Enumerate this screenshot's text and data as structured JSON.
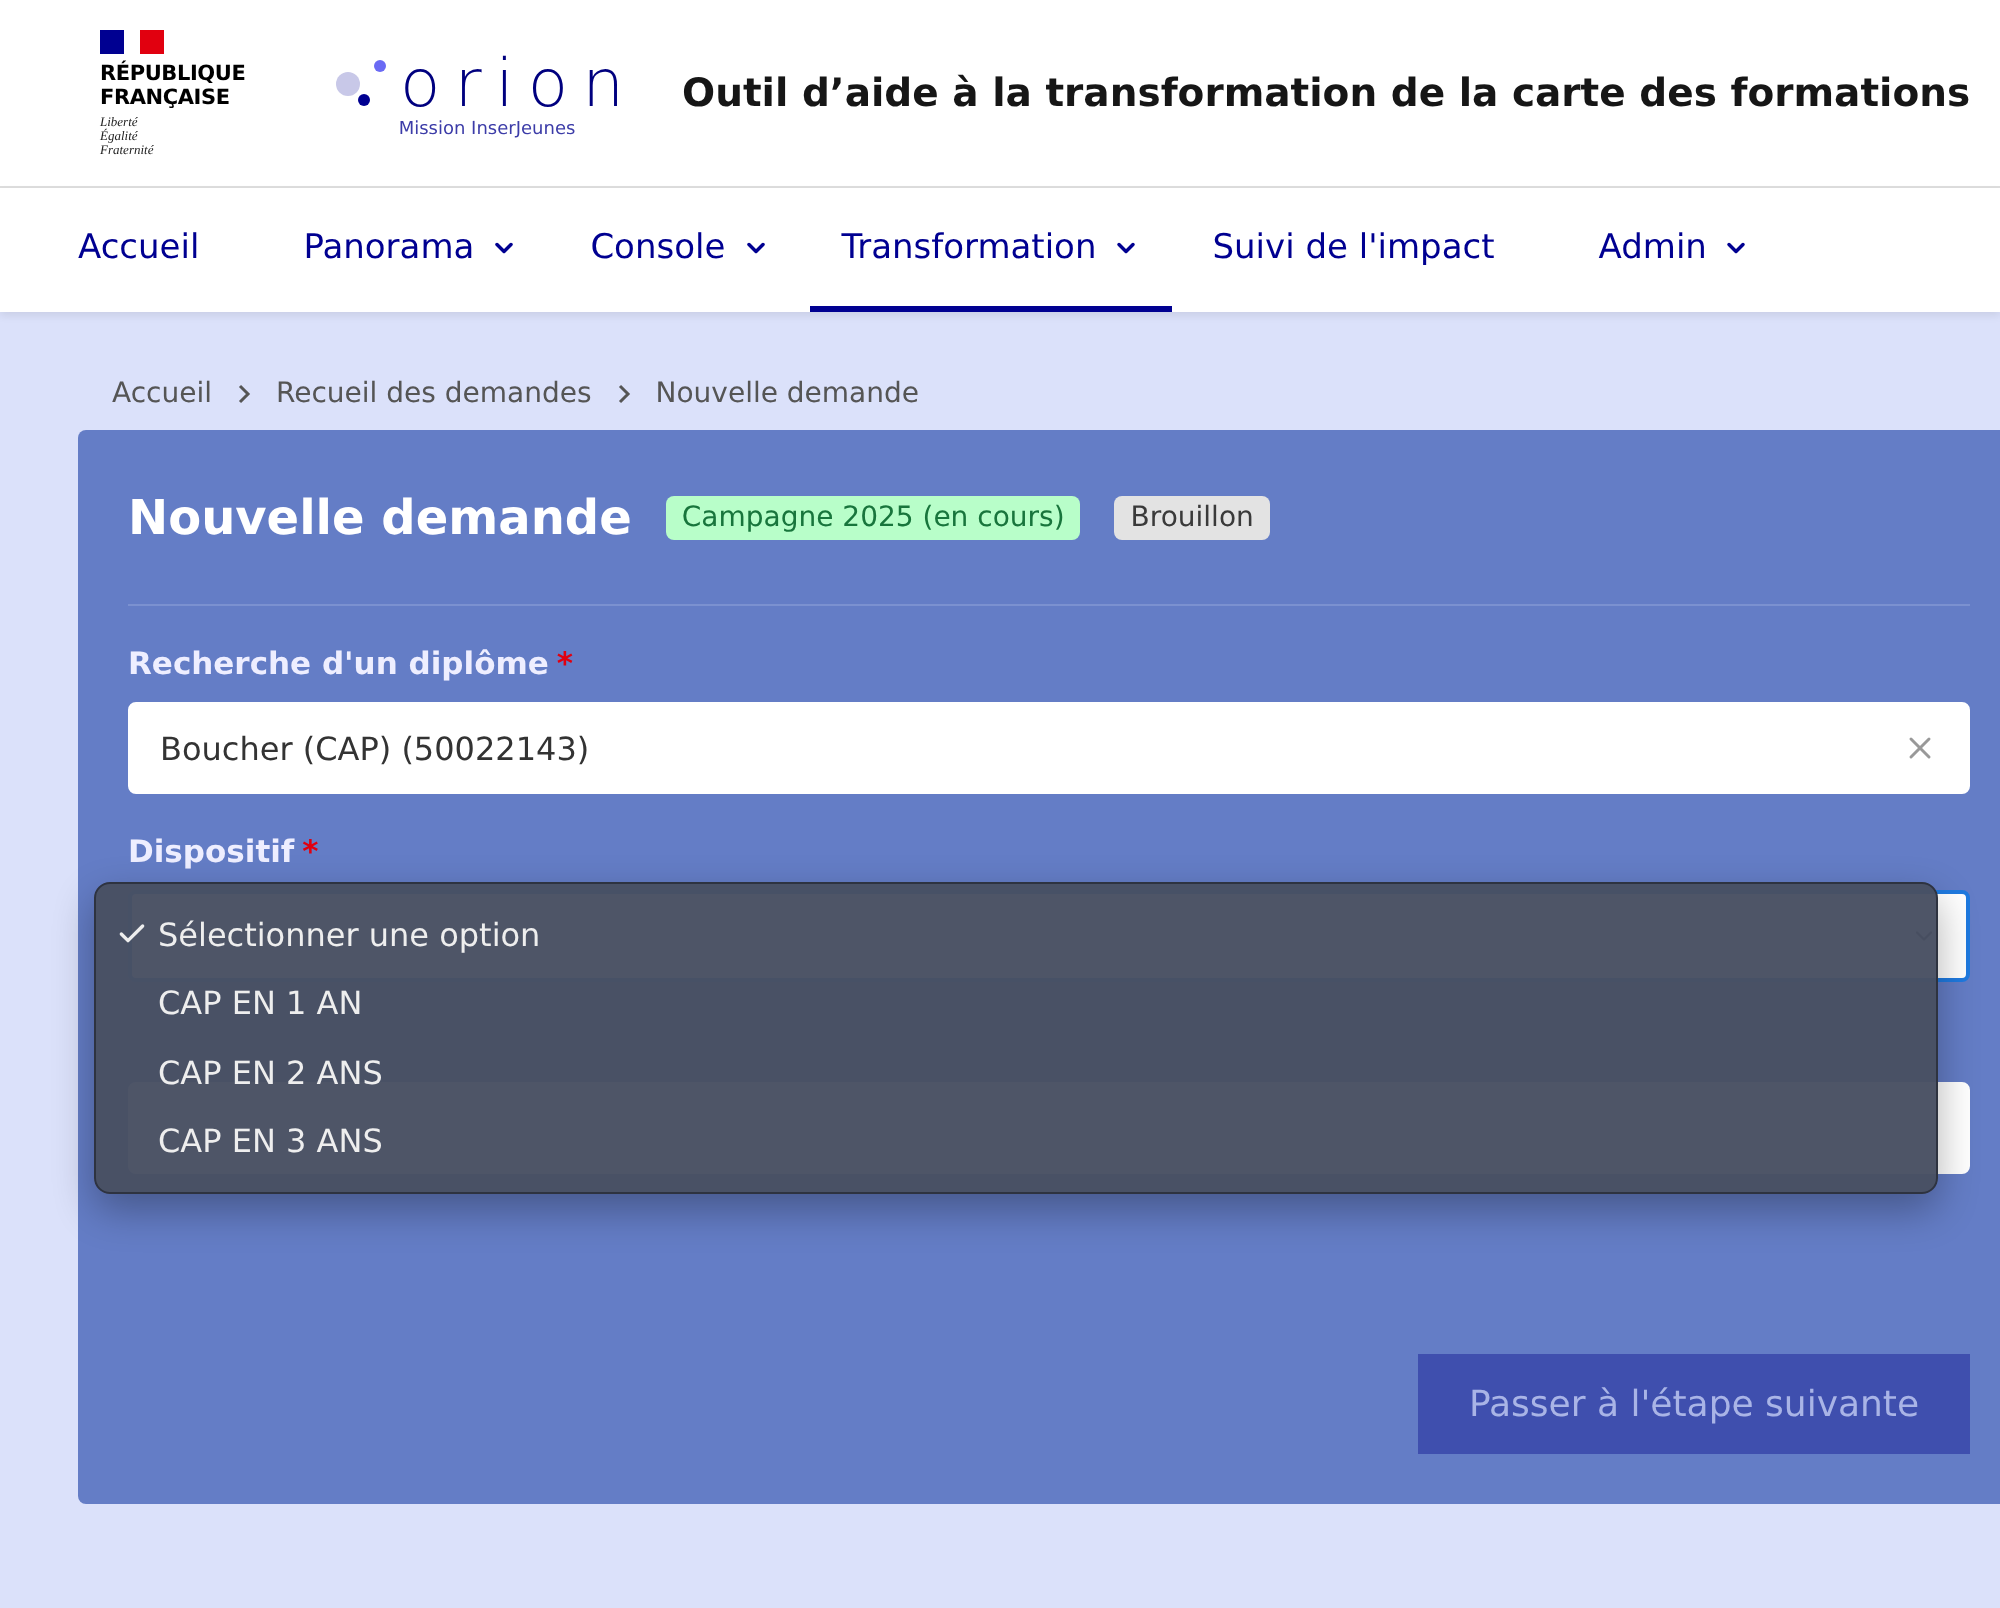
{
  "header": {
    "republic": {
      "name_lines": [
        "RÉPUBLIQUE",
        "FRANÇAISE"
      ],
      "motto": [
        "Liberté",
        "Égalité",
        "Fraternité"
      ]
    },
    "logo": {
      "wordmark": "orion",
      "subtitle": "Mission InserJeunes"
    },
    "title": "Outil d’aide à la transformation de la carte des formations"
  },
  "nav": [
    {
      "label": "Accueil",
      "has_menu": false,
      "selected": false
    },
    {
      "label": "Panorama",
      "has_menu": true,
      "selected": false
    },
    {
      "label": "Console",
      "has_menu": true,
      "selected": false
    },
    {
      "label": "Transformation",
      "has_menu": true,
      "selected": true
    },
    {
      "label": "Suivi de l'impact",
      "has_menu": false,
      "selected": false
    },
    {
      "label": "Admin",
      "has_menu": true,
      "selected": false
    }
  ],
  "breadcrumb": [
    "Accueil",
    "Recueil des demandes",
    "Nouvelle demande"
  ],
  "card": {
    "title": "Nouvelle demande",
    "badges": [
      {
        "label": "Campagne 2025 (en cours)",
        "color": "#b8fec9"
      },
      {
        "label": "Brouillon",
        "color": "#e3e3e3"
      }
    ],
    "fields": [
      {
        "kind": "search",
        "label": "Recherche d'un diplôme",
        "required_mark": "*",
        "value": "Boucher (CAP) (50022143)"
      },
      {
        "kind": "select",
        "label": "Dispositif",
        "required_mark": "*",
        "focused": true,
        "options": [
          {
            "label": "Sélectionner une option",
            "selected": true
          },
          {
            "label": "CAP EN 1 AN",
            "selected": false
          },
          {
            "label": "CAP EN 2 ANS",
            "selected": false
          },
          {
            "label": "CAP EN 3 ANS",
            "selected": false
          }
        ]
      },
      {
        "kind": "input"
      }
    ],
    "next_button": {
      "label": "Passer à l'étape suivante",
      "disabled": true
    }
  }
}
